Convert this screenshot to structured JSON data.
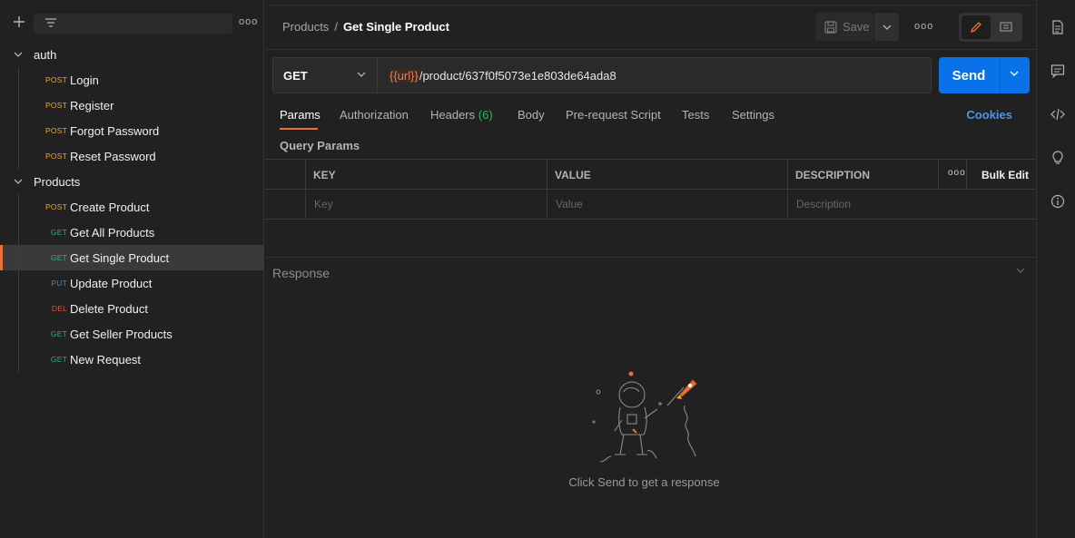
{
  "sidebar": {
    "tree": [
      {
        "type": "folder",
        "label": "auth"
      },
      {
        "type": "request",
        "method": "POST",
        "label": "Login"
      },
      {
        "type": "request",
        "method": "POST",
        "label": "Register"
      },
      {
        "type": "request",
        "method": "POST",
        "label": "Forgot Password"
      },
      {
        "type": "request",
        "method": "POST",
        "label": "Reset Password"
      },
      {
        "type": "folder",
        "label": "Products"
      },
      {
        "type": "request",
        "method": "POST",
        "label": "Create Product"
      },
      {
        "type": "request",
        "method": "GET",
        "label": "Get All Products"
      },
      {
        "type": "request",
        "method": "GET",
        "label": "Get Single Product",
        "selected": true
      },
      {
        "type": "request",
        "method": "PUT",
        "label": "Update Product"
      },
      {
        "type": "request",
        "method": "DEL",
        "label": "Delete Product"
      },
      {
        "type": "request",
        "method": "GET",
        "label": "Get Seller Products"
      },
      {
        "type": "request",
        "method": "GET",
        "label": "New Request"
      }
    ],
    "more_label": "ooo"
  },
  "header": {
    "breadcrumb_parent": "Products",
    "breadcrumb_sep": "/",
    "breadcrumb_current": "Get Single Product",
    "save_label": "Save",
    "more_label": "ooo"
  },
  "request": {
    "method": "GET",
    "url_variable": "{{url}}",
    "url_path": "/product/637f0f5073e1e803de64ada8",
    "send_label": "Send"
  },
  "tabs": {
    "params": "Params",
    "authorization": "Authorization",
    "headers": "Headers",
    "headers_count": "(6)",
    "body": "Body",
    "prerequest": "Pre-request Script",
    "tests": "Tests",
    "settings": "Settings",
    "cookies": "Cookies"
  },
  "query_params": {
    "title": "Query Params",
    "headers": {
      "key": "KEY",
      "value": "VALUE",
      "description": "DESCRIPTION"
    },
    "placeholders": {
      "key": "Key",
      "value": "Value",
      "description": "Description"
    },
    "more_label": "ooo",
    "bulk_edit": "Bulk Edit"
  },
  "response": {
    "title": "Response",
    "hint": "Click Send to get a response"
  },
  "colors": {
    "post": "#f5a623",
    "get": "#2fb36b",
    "put": "#3c8cd8",
    "del": "#e0533b",
    "accent": "#e8703b",
    "send": "#0a72e8",
    "link": "#4e95e8"
  }
}
